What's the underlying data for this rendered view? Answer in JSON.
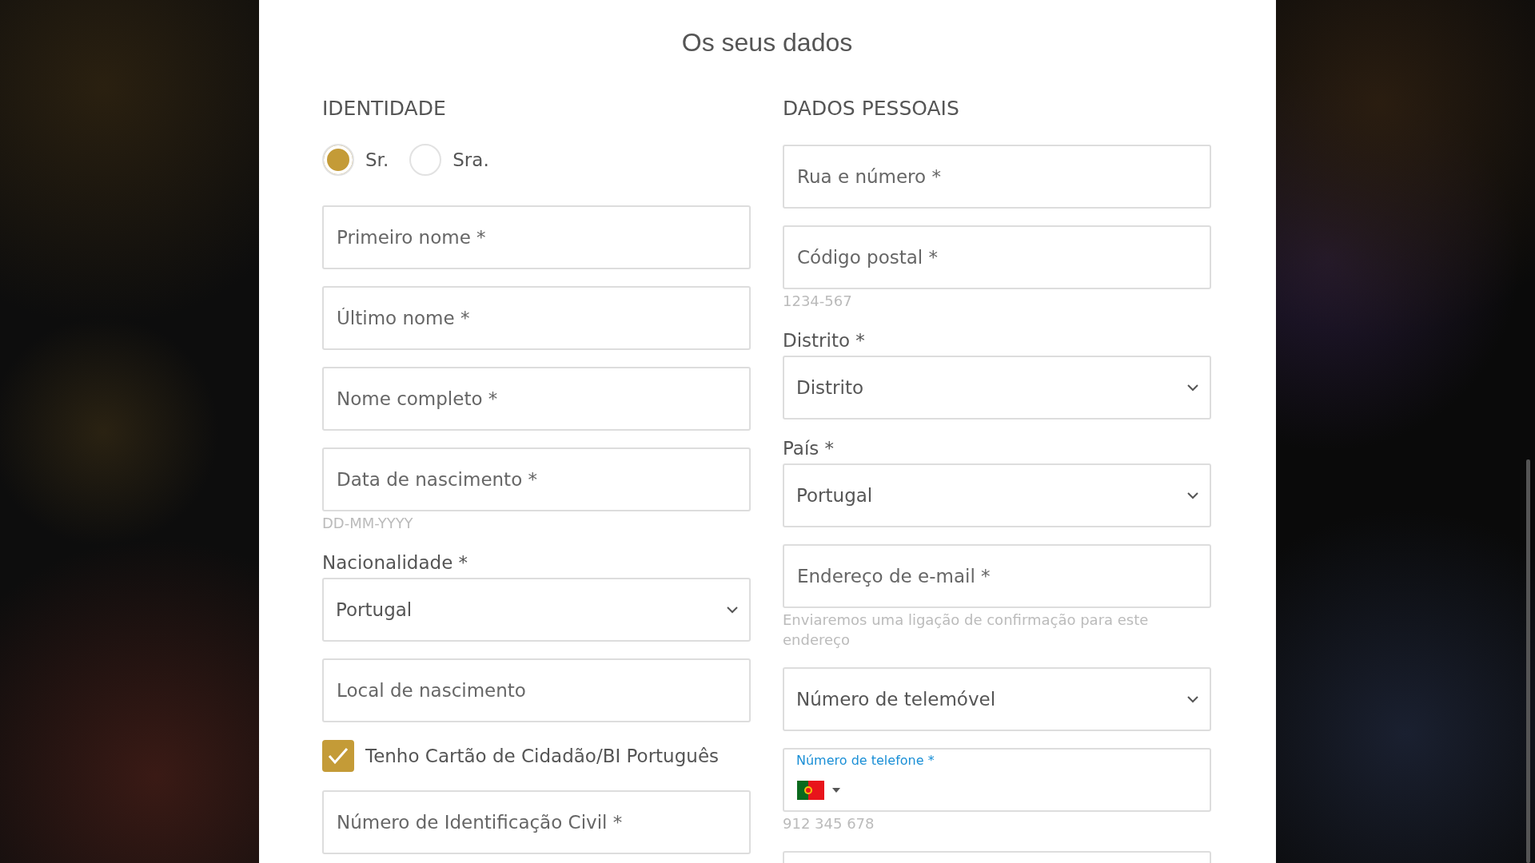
{
  "title": "Os seus dados",
  "identity": {
    "heading": "IDENTIDADE",
    "salutations": [
      {
        "label": "Sr.",
        "selected": true
      },
      {
        "label": "Sra.",
        "selected": false
      }
    ],
    "fields": [
      {
        "kind": "input",
        "placeholder": "Primeiro nome *"
      },
      {
        "kind": "input",
        "placeholder": "Último nome *"
      },
      {
        "kind": "input",
        "placeholder": "Nome completo *"
      },
      {
        "kind": "input",
        "placeholder": "Data de nascimento *",
        "hint": "DD-MM-YYYY"
      },
      {
        "kind": "select",
        "label": "Nacionalidade *",
        "value": "Portugal"
      },
      {
        "kind": "input",
        "placeholder": "Local de nascimento"
      },
      {
        "kind": "checkbox",
        "label": "Tenho Cartão de Cidadão/BI Português",
        "checked": true
      },
      {
        "kind": "input",
        "placeholder": "Número de Identificação Civil *"
      }
    ]
  },
  "personal": {
    "heading": "DADOS PESSOAIS",
    "fields": [
      {
        "kind": "input",
        "placeholder": "Rua e número *"
      },
      {
        "kind": "input",
        "placeholder": "Código postal *",
        "hint": "1234-567"
      },
      {
        "kind": "select",
        "label": "Distrito *",
        "value": "Distrito"
      },
      {
        "kind": "select",
        "label": "País *",
        "value": "Portugal"
      },
      {
        "kind": "input",
        "placeholder": "Endereço de e-mail *",
        "hint": "Enviaremos uma ligação de confirmação para este endereço"
      },
      {
        "kind": "select",
        "value": "Número de telemóvel"
      },
      {
        "kind": "phone",
        "label": "Número de telefone *",
        "hint": "912 345 678"
      },
      {
        "kind": "input"
      }
    ]
  }
}
